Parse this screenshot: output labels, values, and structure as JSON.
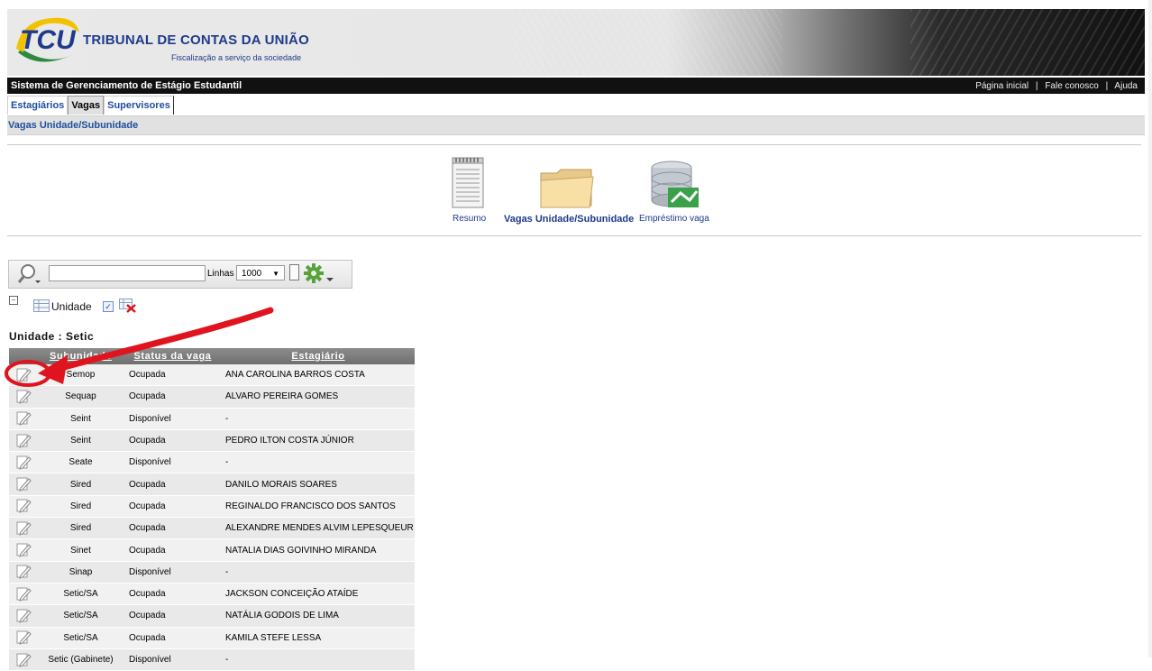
{
  "header": {
    "brand_short": "TCU",
    "brand_title": "TRIBUNAL DE CONTAS DA UNIÃO",
    "brand_subtitle": "Fiscalização a serviço da sociedade",
    "system_name": "Sistema de Gerenciamento de Estágio Estudantil",
    "links": [
      "Página inicial",
      "Fale conosco",
      "Ajuda"
    ],
    "link_separator": "|"
  },
  "tabs": [
    {
      "label": "Estagiários",
      "active": false
    },
    {
      "label": "Vagas",
      "active": true
    },
    {
      "label": "Supervisores",
      "active": false
    }
  ],
  "breadcrumb": "Vagas Unidade/Subunidade",
  "launcher": [
    {
      "label": "Resumo",
      "icon": "document-icon"
    },
    {
      "label": "Vagas Unidade/Subunidade",
      "icon": "folder-icon",
      "active": true
    },
    {
      "label": "Empréstimo vaga",
      "icon": "database-icon"
    }
  ],
  "toolbar": {
    "search_value": "",
    "rows_label": "Linhas",
    "rows_value": "1000"
  },
  "group": {
    "collapse_symbol": "−",
    "label": "Unidade",
    "checked_symbol": "✓"
  },
  "table": {
    "group_title": "Unidade : Setic",
    "columns": [
      "Subunidade",
      "Status da vaga",
      "Estagiário"
    ],
    "rows": [
      {
        "subunidade": "Semop",
        "status": "Ocupada",
        "estagiario": "ANA CAROLINA BARROS COSTA"
      },
      {
        "subunidade": "Sequap",
        "status": "Ocupada",
        "estagiario": "ALVARO PEREIRA GOMES"
      },
      {
        "subunidade": "Seint",
        "status": "Disponível",
        "estagiario": "-"
      },
      {
        "subunidade": "Seint",
        "status": "Ocupada",
        "estagiario": "PEDRO ILTON COSTA JÚNIOR"
      },
      {
        "subunidade": "Seate",
        "status": "Disponível",
        "estagiario": "-"
      },
      {
        "subunidade": "Sired",
        "status": "Ocupada",
        "estagiario": "DANILO MORAIS SOARES"
      },
      {
        "subunidade": "Sired",
        "status": "Ocupada",
        "estagiario": "REGINALDO FRANCISCO DOS SANTOS"
      },
      {
        "subunidade": "Sired",
        "status": "Ocupada",
        "estagiario": "ALEXANDRE MENDES ALVIM LEPESQUEUR"
      },
      {
        "subunidade": "Sinet",
        "status": "Ocupada",
        "estagiario": "NATALIA DIAS GOIVINHO MIRANDA"
      },
      {
        "subunidade": "Sinap",
        "status": "Disponível",
        "estagiario": "-"
      },
      {
        "subunidade": "Setic/SA",
        "status": "Ocupada",
        "estagiario": "JACKSON CONCEIÇÃO ATAÍDE"
      },
      {
        "subunidade": "Setic/SA",
        "status": "Ocupada",
        "estagiario": "NATÁLIA GODOIS DE LIMA"
      },
      {
        "subunidade": "Setic/SA",
        "status": "Ocupada",
        "estagiario": "KAMILA STEFE LESSA"
      },
      {
        "subunidade": "Setic (Gabinete)",
        "status": "Disponível",
        "estagiario": "-"
      }
    ]
  },
  "colors": {
    "brand_blue": "#1f3a8a",
    "link_blue": "#1f4e9c",
    "annotation_red": "#e0141e",
    "header_dark": "#111111",
    "table_header": "#7d7d7d"
  }
}
